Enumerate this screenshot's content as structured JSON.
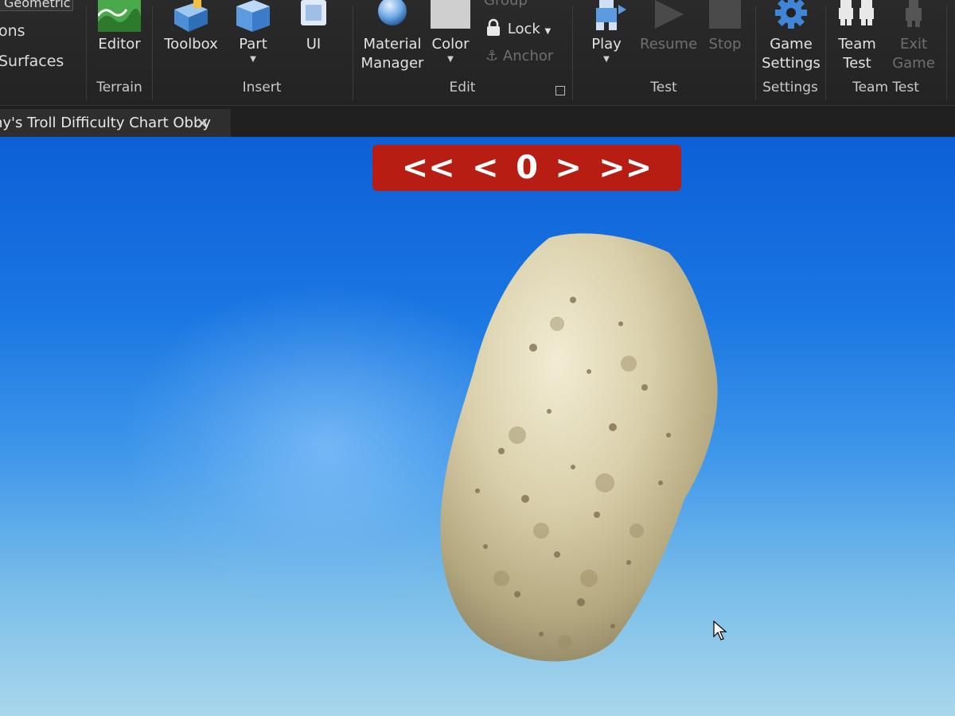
{
  "ribbon": {
    "left_partial": {
      "dropdown_text": "Geometric",
      "items": [
        "ons",
        "Surfaces"
      ]
    },
    "groups": {
      "terrain": {
        "label": "Terrain",
        "tools": {
          "editor": "Editor"
        }
      },
      "insert": {
        "label": "Insert",
        "tools": {
          "toolbox": "Toolbox",
          "part": "Part",
          "ui": "UI"
        }
      },
      "edit": {
        "label": "Edit",
        "tools": {
          "material_manager_line1": "Material",
          "material_manager_line2": "Manager",
          "color": "Color",
          "group": "Group",
          "lock": "Lock",
          "anchor": "Anchor"
        }
      },
      "test": {
        "label": "Test",
        "tools": {
          "play": "Play",
          "resume": "Resume",
          "stop": "Stop"
        }
      },
      "settings": {
        "label": "Settings",
        "tools": {
          "game_settings_line1": "Game",
          "game_settings_line2": "Settings"
        }
      },
      "team_test": {
        "label": "Team Test",
        "tools": {
          "team_test_line1": "Team",
          "team_test_line2": "Test",
          "exit_game_line1": "Exit",
          "exit_game_line2": "Game"
        }
      }
    }
  },
  "tabs": [
    {
      "title": "ny's Troll Difficulty Chart Obby",
      "close": "✕"
    }
  ],
  "viewport": {
    "nav": {
      "first": "<<",
      "prev": "<",
      "current": "0",
      "next": ">",
      "last": ">>"
    },
    "colors": {
      "nav_panel": "#b81d14",
      "sky_top": "#0d5fd6",
      "sky_bottom": "#a9d7ec",
      "rock": "#d8cfae"
    }
  },
  "icons": {
    "editor": "terrain-editor-icon",
    "toolbox": "toolbox-icon",
    "part": "part-cube-icon",
    "ui": "ui-frame-icon",
    "material_manager": "material-sphere-icon",
    "color": "color-swatch-icon",
    "lock": "lock-icon",
    "anchor": "anchor-icon",
    "play": "play-character-icon",
    "resume": "resume-icon",
    "stop": "stop-icon",
    "game_settings": "gear-icon",
    "team_test": "team-icon",
    "exit_game": "exit-game-icon"
  }
}
